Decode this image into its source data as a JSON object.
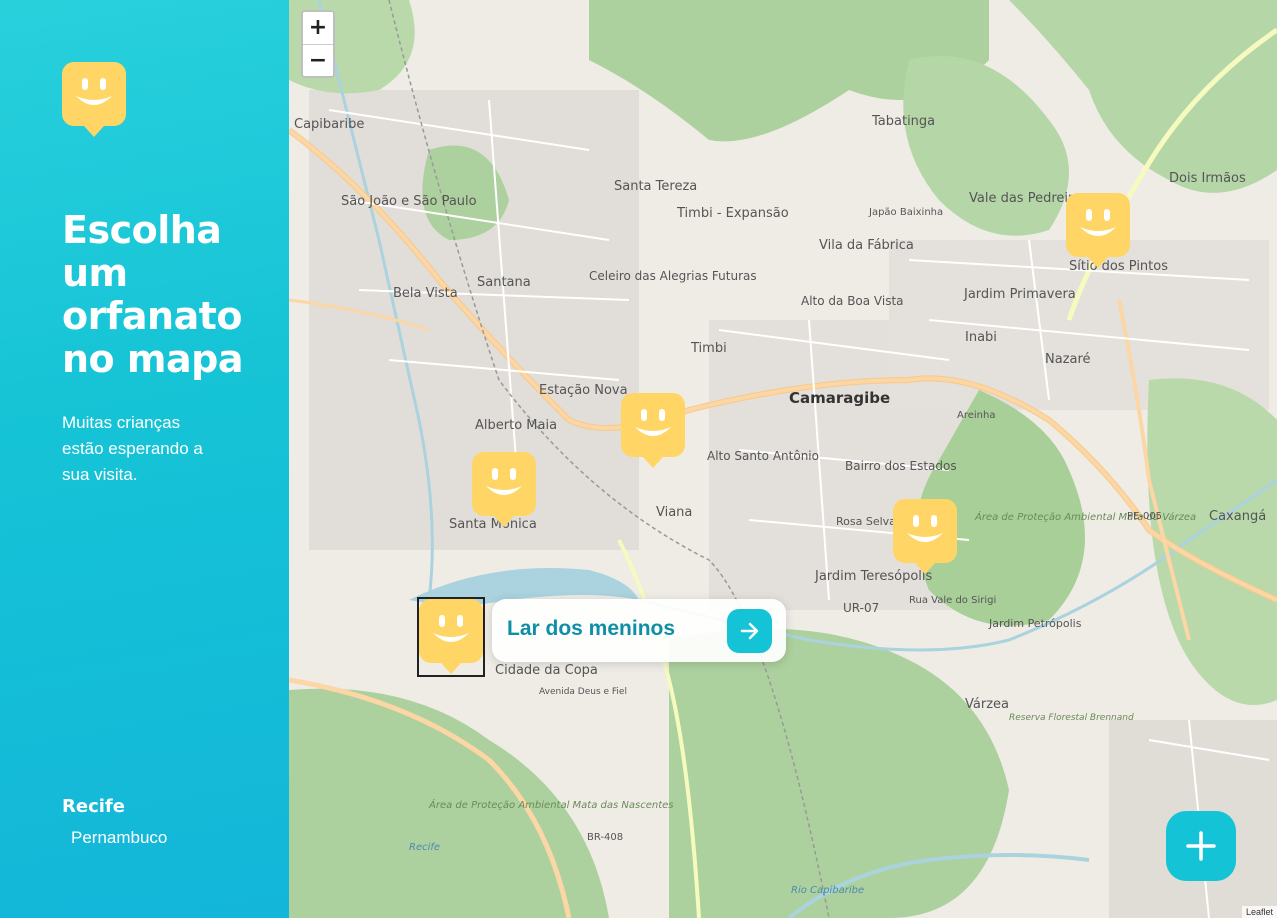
{
  "sidebar": {
    "logo_icon": "smiling-map-pin-icon",
    "headline": "Escolha um orfanato no mapa",
    "subtext": "Muitas crianças estão esperando a sua visita.",
    "location": {
      "city": "Recife",
      "state": "Pernambuco"
    }
  },
  "map": {
    "zoom_in": "+",
    "zoom_out": "−",
    "labels": [
      "Capibaribe",
      "São João e São Paulo",
      "Santa Tereza",
      "Tabatinga",
      "Japão Baixinha",
      "Vale das Pedreiras",
      "Dois Irmãos",
      "Timbi - Expansão",
      "Vila da Fábrica",
      "Santana",
      "Celeiro das Alegrias Futuras",
      "Bela Vista",
      "Alto da Boa Vista",
      "Jardim Primavera",
      "Sítio dos Pintos",
      "Inabi",
      "Nazaré",
      "Timbi",
      "Estação Nova",
      "Camaragibe",
      "Alberto Maia",
      "Areinha",
      "Alto Santo Antônio",
      "Bairro dos Estados",
      "Santa Mônica",
      "Viana",
      "Rosa Selva",
      "Área de Proteção Ambiental Mata da Várzea",
      "Jardim Teresópolis",
      "UR-07",
      "Rua Vale do Sirigi",
      "Jardim Petrópolis",
      "Cidade da Copa",
      "Avenida Deus e Fiel",
      "Várzea",
      "Reserva Florestal Brennand",
      "Área de Proteção Ambiental Mata das Nascentes",
      "BR-408",
      "PE-005",
      "Caxangá",
      "Rio Capibaribe",
      "Recife"
    ],
    "popup": {
      "title": "Lar dos meninos",
      "button_icon": "arrow-right-icon"
    },
    "add_button_icon": "plus-icon",
    "attribution": "Leaflet",
    "accent": "#15c3d6",
    "pin_color": "#ffd666"
  }
}
